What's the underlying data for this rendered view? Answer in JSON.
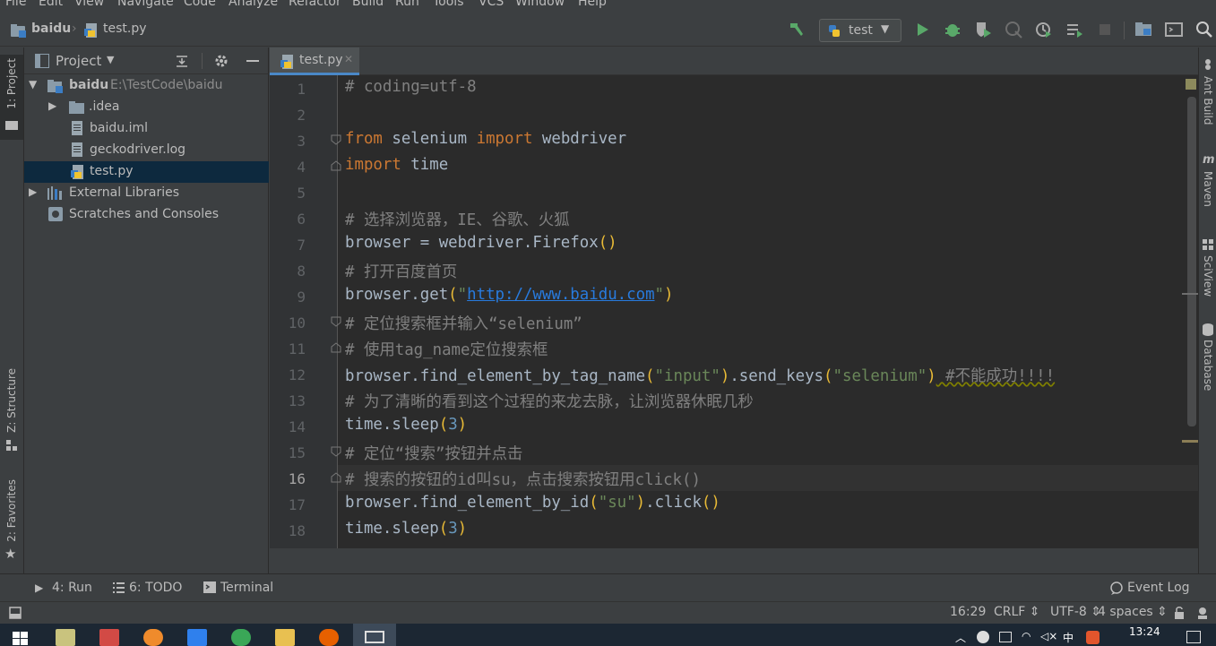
{
  "menu": [
    "File",
    "Edit",
    "View",
    "Navigate",
    "Code",
    "Analyze",
    "Refactor",
    "Build",
    "Run",
    "Tools",
    "VCS",
    "Window",
    "Help"
  ],
  "breadcrumb": {
    "project": "baidu",
    "file": "test.py"
  },
  "run_config": {
    "name": "test"
  },
  "left_tabs": {
    "project": "1: Project",
    "structure": "Z: Structure",
    "favorites": "2: Favorites"
  },
  "project_panel": {
    "title": "Project",
    "tree": [
      {
        "label": "baidu",
        "path": "E:\\TestCode\\baidu"
      },
      {
        "label": ".idea"
      },
      {
        "label": "baidu.iml"
      },
      {
        "label": "geckodriver.log"
      },
      {
        "label": "test.py"
      },
      {
        "label": "External Libraries"
      },
      {
        "label": "Scratches and Consoles"
      }
    ]
  },
  "editor": {
    "tab": "test.py",
    "current_line": 16,
    "line_numbers": [
      "1",
      "2",
      "3",
      "4",
      "5",
      "6",
      "7",
      "8",
      "9",
      "10",
      "11",
      "12",
      "13",
      "14",
      "15",
      "16",
      "17",
      "18"
    ],
    "lines": {
      "l1": "# coding=utf-8",
      "l3_kw1": "from",
      "l3_a": " selenium ",
      "l3_kw2": "import",
      "l3_b": " webdriver",
      "l4_kw": "import",
      "l4_a": " time",
      "l6": "# 选择浏览器，IE、谷歌、火狐",
      "l7_a": "browser = webdriver.Firefox",
      "l7_p": "()",
      "l8": "# 打开百度首页",
      "l9_a": "browser.get",
      "l9_p1": "(",
      "l9_q1": "\"",
      "l9_url": "http://www.baidu.com",
      "l9_q2": "\"",
      "l9_p2": ")",
      "l10": "# 定位搜索框并输入“selenium”",
      "l11": "# 使用tag_name定位搜索框",
      "l12_a": "browser.find_element_by_tag_name",
      "l12_p1": "(",
      "l12_s1": "\"input\"",
      "l12_p2": ")",
      "l12_b": ".send_keys",
      "l12_p3": "(",
      "l12_s2": "\"selenium\"",
      "l12_p4": ")",
      "l12_c": " #不能成功!!!!",
      "l13": "# 为了清晰的看到这个过程的来龙去脉，让浏览器休眠几秒",
      "l14_a": "time.sleep",
      "l14_p1": "(",
      "l14_n": "3",
      "l14_p2": ")",
      "l15": "# 定位“搜索”按钮并点击",
      "l16": "# 搜索的按钮的id叫su，点击搜索按钮用click()",
      "l17_a": "browser.find_element_by_id",
      "l17_p1": "(",
      "l17_s": "\"su\"",
      "l17_p2": ")",
      "l17_b": ".click",
      "l17_p3": "()",
      "l18_a": "time.sleep",
      "l18_p1": "(",
      "l18_n": "3",
      "l18_p2": ")"
    }
  },
  "right_tabs": {
    "ant": "Ant Build",
    "maven": "Maven",
    "sciview": "SciView",
    "database": "Database"
  },
  "bottom_tabs": {
    "run": "4: Run",
    "todo": "6: TODO",
    "terminal": "Terminal",
    "event_log": "Event Log"
  },
  "status": {
    "position": "16:29",
    "line_sep": "CRLF ⇕",
    "encoding": "UTF-8 ⇕",
    "indent": "4 spaces ⇕"
  },
  "taskbar": {
    "clock": "13:24",
    "ime": "中"
  },
  "colors": {
    "keyword": "#cc7832",
    "comment": "#808080",
    "string": "#6a8759",
    "number": "#6897bb",
    "selection": "#0d293e"
  }
}
